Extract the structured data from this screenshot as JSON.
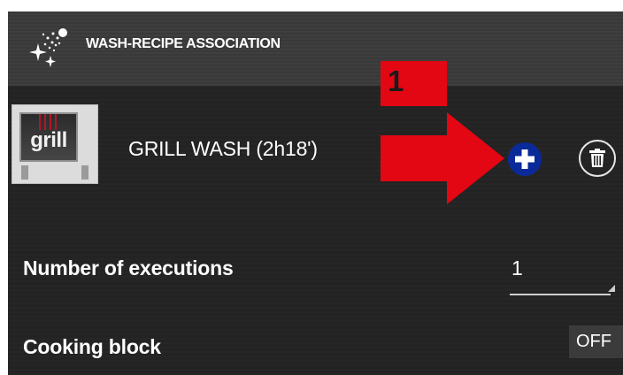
{
  "header": {
    "title": "WASH-RECIPE ASSOCIATION",
    "icon": "sparkle-icon"
  },
  "recipe": {
    "thumbnail_label": "grill",
    "name": "GRILL WASH (2h18')",
    "add_icon": "plus-icon",
    "delete_icon": "trash-icon"
  },
  "annotation": {
    "marker_number": "1",
    "color": "#e30613"
  },
  "settings": {
    "executions_label": "Number of executions",
    "executions_value": "1",
    "cooking_block_label": "Cooking block",
    "cooking_block_value": "OFF"
  },
  "colors": {
    "header_bg": "#3d3d3d",
    "body_bg": "#252525",
    "add_button": "#0b2a9a"
  }
}
